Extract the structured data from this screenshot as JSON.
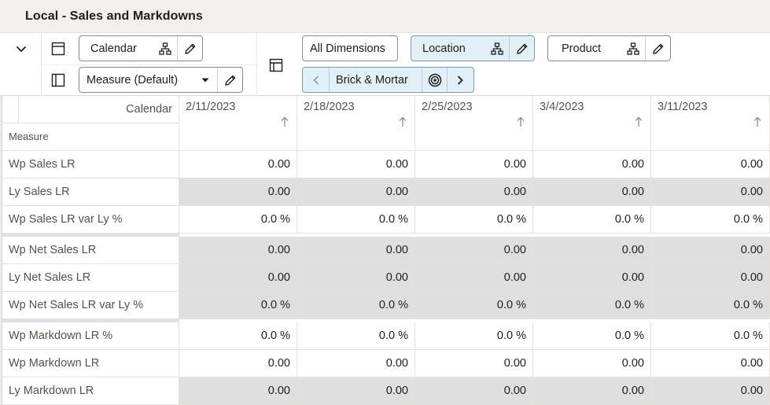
{
  "window": {
    "title": "Local - Sales and Markdowns"
  },
  "toolbar": {
    "collapse_icon": "chevron-down-icon",
    "row_axis": {
      "layout_icon": "column-layout-icon",
      "dimension_label": "Calendar",
      "hierarchy_icon": "hierarchy-icon",
      "edit_icon": "pencil-icon"
    },
    "measure_axis": {
      "layout_icon": "row-layout-icon",
      "dimension_label": "Measure (Default)",
      "dropdown_icon": "caret-down-icon",
      "edit_icon": "pencil-icon"
    },
    "page_axis_icon": "page-layout-icon",
    "all_dimensions_label": "All Dimensions",
    "location": {
      "label": "Location",
      "hierarchy_icon": "hierarchy-icon",
      "edit_icon": "pencil-icon",
      "current_value": "Brick & Mortar",
      "prev_icon": "chevron-left-icon",
      "target_icon": "target-icon",
      "next_icon": "chevron-right-icon"
    },
    "product": {
      "label": "Product",
      "hierarchy_icon": "hierarchy-icon",
      "edit_icon": "pencil-icon"
    }
  },
  "grid": {
    "corner": {
      "calendar_label": "Calendar",
      "measure_label": "Measure"
    },
    "columns": [
      {
        "label": "2/11/2023",
        "sort_icon": "arrow-up-icon"
      },
      {
        "label": "2/18/2023",
        "sort_icon": "arrow-up-icon"
      },
      {
        "label": "2/25/2023",
        "sort_icon": "arrow-up-icon"
      },
      {
        "label": "3/4/2023",
        "sort_icon": "arrow-up-icon"
      },
      {
        "label": "3/11/2023",
        "sort_icon": "arrow-up-icon"
      }
    ],
    "rows": [
      {
        "label": "Wp Sales LR",
        "editable": true,
        "values": [
          "0.00",
          "0.00",
          "0.00",
          "0.00",
          "0.00"
        ]
      },
      {
        "label": "Ly Sales LR",
        "editable": false,
        "values": [
          "0.00",
          "0.00",
          "0.00",
          "0.00",
          "0.00"
        ]
      },
      {
        "label": "Wp Sales LR var Ly %",
        "editable": true,
        "values": [
          "0.0 %",
          "0.0 %",
          "0.0 %",
          "0.0 %",
          "0.0 %"
        ]
      },
      {
        "label": "Wp Net Sales LR",
        "editable": false,
        "values": [
          "0.00",
          "0.00",
          "0.00",
          "0.00",
          "0.00"
        ]
      },
      {
        "label": "Ly Net Sales LR",
        "editable": false,
        "values": [
          "0.00",
          "0.00",
          "0.00",
          "0.00",
          "0.00"
        ]
      },
      {
        "label": "Wp Net Sales LR var Ly %",
        "editable": false,
        "values": [
          "0.0 %",
          "0.0 %",
          "0.0 %",
          "0.0 %",
          "0.0 %"
        ]
      },
      {
        "label": "Wp Markdown LR %",
        "editable": true,
        "values": [
          "0.0 %",
          "0.0 %",
          "0.0 %",
          "0.0 %",
          "0.0 %"
        ]
      },
      {
        "label": "Wp Markdown LR",
        "editable": true,
        "values": [
          "0.00",
          "0.00",
          "0.00",
          "0.00",
          "0.00"
        ]
      },
      {
        "label": "Ly Markdown LR",
        "editable": false,
        "values": [
          "0.00",
          "0.00",
          "0.00",
          "0.00",
          "0.00"
        ]
      }
    ]
  }
}
